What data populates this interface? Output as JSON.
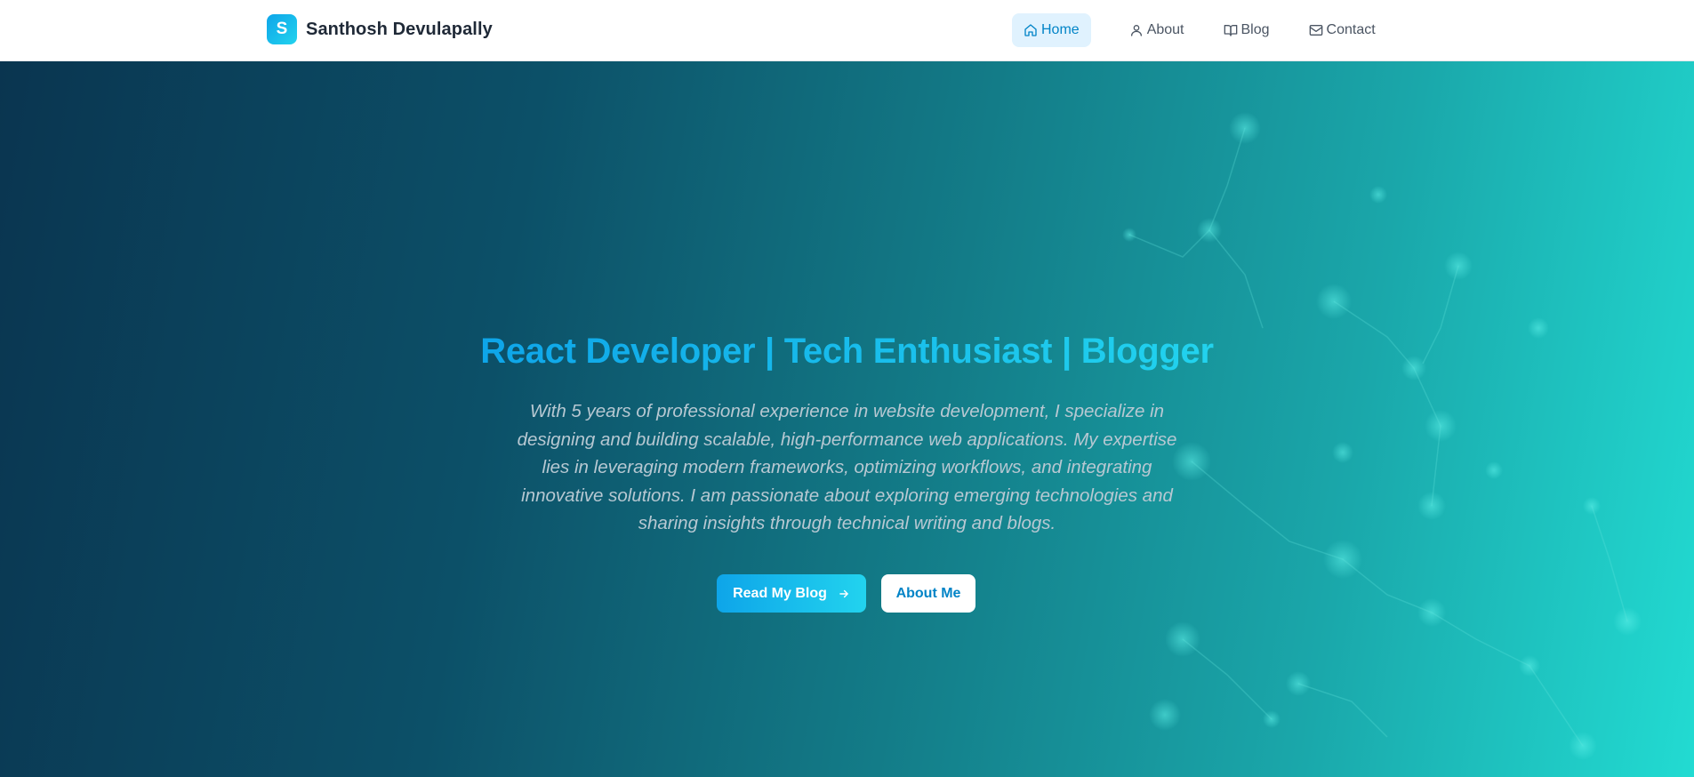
{
  "header": {
    "logo_letter": "S",
    "brand_name": "Santhosh Devulapally",
    "nav": [
      {
        "label": "Home",
        "icon": "home-icon",
        "active": true
      },
      {
        "label": "About",
        "icon": "user-icon",
        "active": false
      },
      {
        "label": "Blog",
        "icon": "book-icon",
        "active": false
      },
      {
        "label": "Contact",
        "icon": "mail-icon",
        "active": false
      }
    ]
  },
  "hero": {
    "headline": "React Developer | Tech Enthusiast | Blogger",
    "intro": "With 5 years of professional experience in website development, I specialize in designing and building scalable, high-performance web applications. My expertise lies in leveraging modern frameworks, optimizing workflows, and integrating innovative solutions. I am passionate about exploring emerging technologies and sharing insights through technical writing and blogs.",
    "primary_button": "Read My Blog",
    "primary_button_icon": "arrow-right-icon",
    "secondary_button": "About Me"
  },
  "colors": {
    "accent_start": "#0ea5e9",
    "accent_end": "#22d3ee",
    "nav_active_bg": "#e0f2fe",
    "nav_active_text": "#0284c7",
    "hero_dark": "#0a3550",
    "hero_light": "#22dbd2"
  }
}
